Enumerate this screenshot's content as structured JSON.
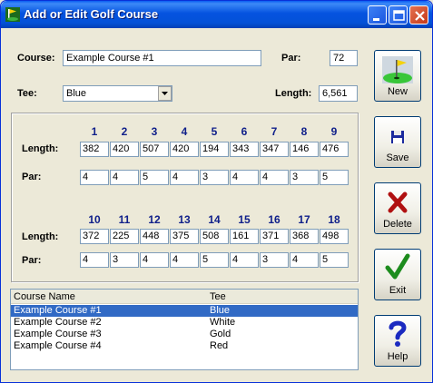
{
  "window": {
    "title": "Add or Edit Golf Course"
  },
  "form": {
    "course_label": "Course:",
    "course_value": "Example Course #1",
    "par_label": "Par:",
    "par_value": "72",
    "tee_label": "Tee:",
    "tee_value": "Blue",
    "length_label": "Length:",
    "length_value": "6,561"
  },
  "holes": {
    "length_label": "Length:",
    "par_label": "Par:",
    "front": {
      "numbers": [
        "1",
        "2",
        "3",
        "4",
        "5",
        "6",
        "7",
        "8",
        "9"
      ],
      "lengths": [
        "382",
        "420",
        "507",
        "420",
        "194",
        "343",
        "347",
        "146",
        "476"
      ],
      "pars": [
        "4",
        "4",
        "5",
        "4",
        "3",
        "4",
        "4",
        "3",
        "5"
      ]
    },
    "back": {
      "numbers": [
        "10",
        "11",
        "12",
        "13",
        "14",
        "15",
        "16",
        "17",
        "18"
      ],
      "lengths": [
        "372",
        "225",
        "448",
        "375",
        "508",
        "161",
        "371",
        "368",
        "498"
      ],
      "pars": [
        "4",
        "3",
        "4",
        "4",
        "5",
        "4",
        "3",
        "4",
        "5"
      ]
    }
  },
  "buttons": {
    "new": {
      "label": "New",
      "icon": "flag-green-icon"
    },
    "save": {
      "label": "Save",
      "icon": "floppy-disk-icon"
    },
    "delete": {
      "label": "Delete",
      "icon": "red-x-icon"
    },
    "exit": {
      "label": "Exit",
      "icon": "green-checkmark-icon"
    },
    "help": {
      "label": "Help",
      "icon": "question-mark-icon"
    }
  },
  "list": {
    "columns": [
      "Course Name",
      "Tee"
    ],
    "rows": [
      {
        "name": "Example Course #1",
        "tee": "Blue",
        "selected": true
      },
      {
        "name": "Example Course #2",
        "tee": "White",
        "selected": false
      },
      {
        "name": "Example Course #3",
        "tee": "Gold",
        "selected": false
      },
      {
        "name": "Example Course #4",
        "tee": "Red",
        "selected": false
      }
    ]
  },
  "colors": {
    "titlebar": "#0553e0",
    "selection": "#316ac5",
    "hole_number": "#10208a"
  }
}
